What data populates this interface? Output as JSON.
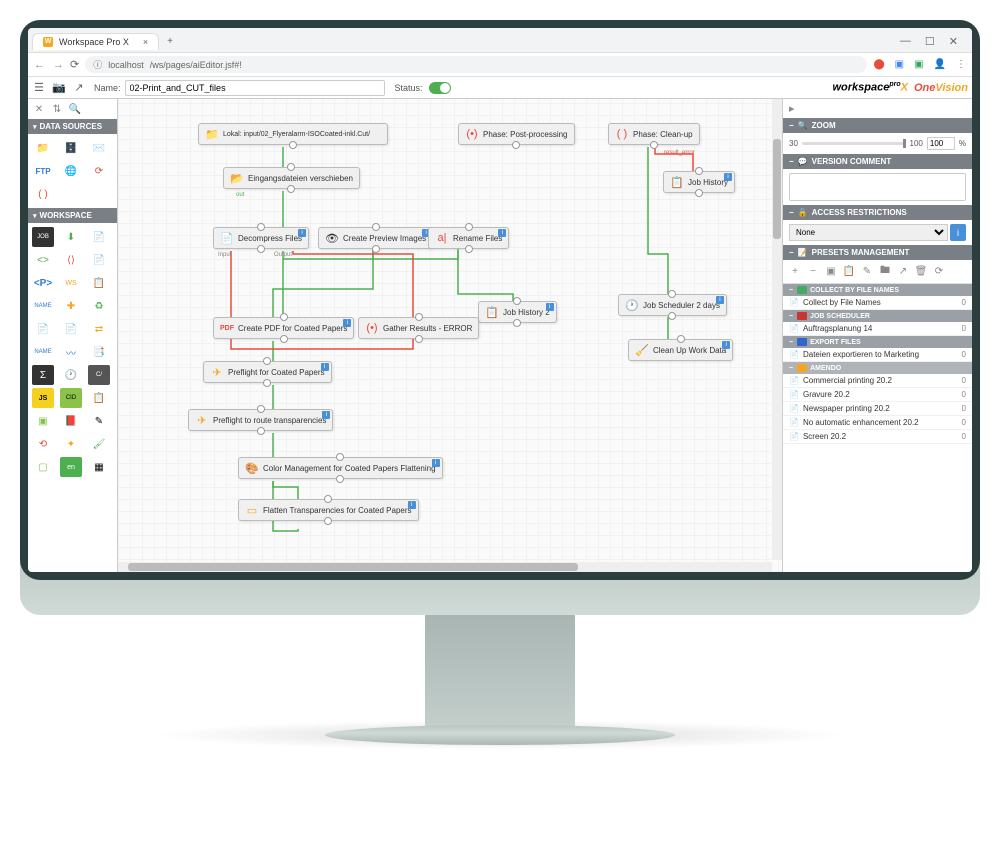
{
  "browser": {
    "tab_title": "Workspace Pro X",
    "tab_favicon": "W",
    "url_prefix": "localhost",
    "url_path": "/ws/pages/aiEditor.jsf#!",
    "window_controls": [
      "—",
      "☐",
      "✕"
    ]
  },
  "toolbar": {
    "name_label": "Name:",
    "name_value": "02-Print_and_CUT_files",
    "status_label": "Status:",
    "brand_workspace": "workspace",
    "brand_workspace_suffix": "X",
    "brand_workspace_tag": "pro",
    "brand_onevision_one": "One",
    "brand_onevision_vision": "Vision"
  },
  "left_panels": {
    "data_sources": "DATA SOURCES",
    "workspace": "WORKSPACE"
  },
  "nodes": {
    "input_folder": "Lokal: input/02_Flyeralarm-ISOCoated-inkl.Cut/",
    "phase_post": "Phase: Post-processing",
    "phase_cleanup": "Phase: Clean-up",
    "move_input": "Eingangsdateien verschieben",
    "job_history": "Job History",
    "decompress": "Decompress Files",
    "create_preview": "Create Preview Images",
    "rename": "Rename Files",
    "job_scheduler": "Job Scheduler 2 days",
    "job_history2": "Job History 2",
    "clean_up": "Clean Up Work Data",
    "create_pdf": "Create PDF for Coated Papers",
    "gather_results": "Gather Results - ERROR",
    "preflight_coated": "Preflight for Coated Papers",
    "preflight_transp": "Preflight to route transparencies",
    "color_mgmt": "Color Management for Coated Papers Flattening",
    "flatten": "Flatten Transparencies for Coated Papers",
    "label_result_error": "result_error",
    "label_input": "Input",
    "label_output": "Output",
    "label_out": "out"
  },
  "right": {
    "zoom_header": "ZOOM",
    "zoom_min": "30",
    "zoom_max": "100",
    "zoom_value": "100",
    "zoom_pct": "%",
    "version_comment": "VERSION COMMENT",
    "access_restrictions": "ACCESS RESTRICTIONS",
    "access_value": "None",
    "presets_management": "PRESETS MANAGEMENT",
    "sections": {
      "collect": {
        "title": "COLLECT BY FILE NAMES",
        "items": [
          {
            "label": "Collect by File Names",
            "count": "0"
          }
        ]
      },
      "job_scheduler": {
        "title": "JOB SCHEDULER",
        "items": [
          {
            "label": "Auftragsplanung 14",
            "count": "0"
          }
        ]
      },
      "export": {
        "title": "EXPORT FILES",
        "items": [
          {
            "label": "Dateien exportieren to Marketing",
            "count": "0"
          }
        ]
      },
      "amendo": {
        "title": "AMENDO",
        "items": [
          {
            "label": "Commercial printing 20.2",
            "count": "0"
          },
          {
            "label": "Gravure 20.2",
            "count": "0"
          },
          {
            "label": "Newspaper printing 20.2",
            "count": "0"
          },
          {
            "label": "No automatic enhancement 20.2",
            "count": "0"
          },
          {
            "label": "Screen 20.2",
            "count": "0"
          }
        ]
      }
    }
  }
}
